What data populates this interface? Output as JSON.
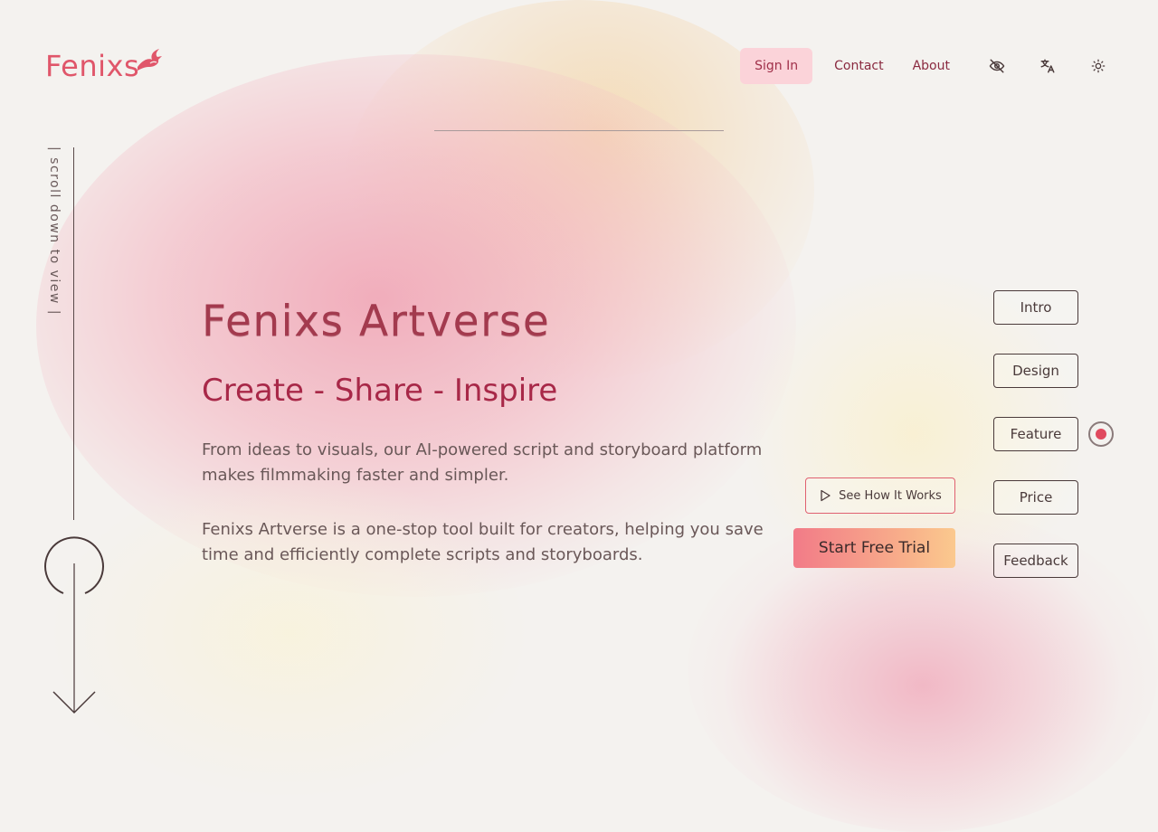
{
  "brand": {
    "name": "Fenixs",
    "accent": "#e0566a"
  },
  "nav": {
    "signin": "Sign In",
    "contact": "Contact",
    "about": "About",
    "icons": [
      "eye-off-icon",
      "translate-icon",
      "sun-icon"
    ]
  },
  "scroll_hint": "| scroll down to view |",
  "hero": {
    "title": "Fenixs Artverse",
    "subtitle": "Create - Share - Inspire",
    "paragraph1": "From ideas to visuals, our AI-powered script and storyboard platform makes filmmaking faster and simpler.",
    "paragraph2": "Fenixs Artverse is a one-stop tool built for creators, helping you save time and efficiently complete scripts and storyboards.",
    "see_how": "See How It Works",
    "trial": "Start Free Trial"
  },
  "side_nav": {
    "items": [
      "Intro",
      "Design",
      "Feature",
      "Price",
      "Feedback"
    ],
    "active": "Feature"
  }
}
